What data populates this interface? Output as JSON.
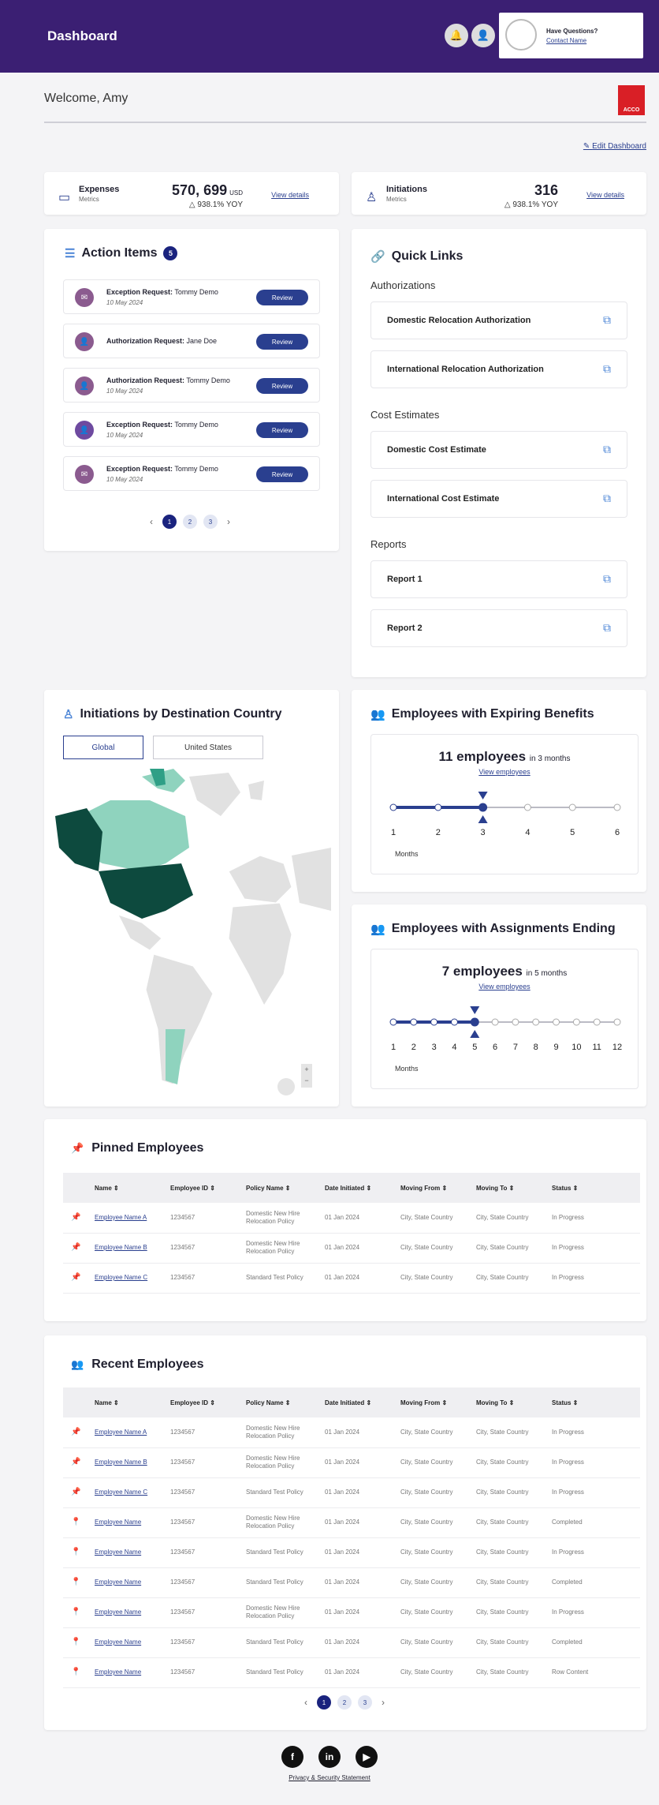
{
  "header": {
    "title": "Dashboard",
    "contact_question": "Have Questions?",
    "contact_link": "Contact Name"
  },
  "welcome": "Welcome, Amy",
  "logo_text": "ACCO",
  "edit_dashboard": "Edit Dashboard",
  "metrics": [
    {
      "label": "Expenses",
      "sub": "Metrics",
      "value": "570, 699",
      "unit": "USD",
      "yoy": "△ 938.1% YOY",
      "link": "View details"
    },
    {
      "label": "Initiations",
      "sub": "Metrics",
      "value": "316",
      "unit": "",
      "yoy": "△ 938.1% YOY",
      "link": "View details"
    }
  ],
  "action_items": {
    "title": "Action Items",
    "count": "5",
    "button": "Review",
    "items": [
      {
        "type": "Exception Request:",
        "who": "Tommy Demo",
        "date": "10 May 2024"
      },
      {
        "type": "Authorization Request:",
        "who": "Jane Doe",
        "date": ""
      },
      {
        "type": "Authorization Request:",
        "who": "Tommy Demo",
        "date": "10 May 2024"
      },
      {
        "type": "Exception Request:",
        "who": "Tommy Demo",
        "date": "10 May 2024"
      },
      {
        "type": "Exception Request:",
        "who": "Tommy Demo",
        "date": "10 May 2024"
      }
    ],
    "pages": [
      "1",
      "2",
      "3"
    ]
  },
  "quick_links": {
    "title": "Quick Links",
    "groups": [
      {
        "heading": "Authorizations",
        "links": [
          "Domestic Relocation Authorization",
          "International Relocation Authorization"
        ]
      },
      {
        "heading": "Cost Estimates",
        "links": [
          "Domestic Cost Estimate",
          "International Cost Estimate"
        ]
      },
      {
        "heading": "Reports",
        "links": [
          "Report 1",
          "Report 2"
        ]
      }
    ]
  },
  "initiations_map": {
    "title": "Initiations by Destination Country",
    "tabs": [
      "Global",
      "United States"
    ],
    "active_tab": "Global",
    "colors": {
      "high": "#0d4a3e",
      "mid": "#2f9f86",
      "low": "#8fd3be",
      "none": "#e1e1e1"
    }
  },
  "expiring": {
    "title": "Employees with Expiring Benefits",
    "count": "11 employees",
    "suffix": "in 3 months",
    "link": "View employees",
    "months": [
      "1",
      "2",
      "3",
      "4",
      "5",
      "6"
    ],
    "current": 3,
    "axis_label": "Months"
  },
  "assignments": {
    "title": "Employees with Assignments Ending",
    "count": "7 employees",
    "suffix": "in 5 months",
    "link": "View employees",
    "months": [
      "1",
      "2",
      "3",
      "4",
      "5",
      "6",
      "7",
      "8",
      "9",
      "10",
      "11",
      "12"
    ],
    "current": 5,
    "axis_label": "Months"
  },
  "table_headers": [
    "Name ⇕",
    "Employee ID ⇕",
    "Policy Name ⇕",
    "Date Initiated ⇕",
    "Moving From ⇕",
    "Moving To ⇕",
    "Status ⇕"
  ],
  "pinned": {
    "title": "Pinned Employees",
    "rows": [
      {
        "name": "Employee Name A",
        "id": "1234567",
        "policy": "Domestic New Hire Relocation Policy",
        "date": "01 Jan 2024",
        "from": "City, State Country",
        "to": "City, State Country",
        "status": "In Progress",
        "pinned": true
      },
      {
        "name": "Employee Name B",
        "id": "1234567",
        "policy": "Domestic New Hire Relocation Policy",
        "date": "01 Jan 2024",
        "from": "City, State Country",
        "to": "City, State Country",
        "status": "In Progress",
        "pinned": true
      },
      {
        "name": "Employee Name C",
        "id": "1234567",
        "policy": "Standard Test Policy",
        "date": "01 Jan 2024",
        "from": "City, State Country",
        "to": "City, State Country",
        "status": "In Progress",
        "pinned": true
      }
    ]
  },
  "recent": {
    "title": "Recent Employees",
    "pages": [
      "1",
      "2",
      "3"
    ],
    "rows": [
      {
        "name": "Employee Name A",
        "id": "1234567",
        "policy": "Domestic New Hire Relocation Policy",
        "date": "01 Jan 2024",
        "from": "City, State Country",
        "to": "City, State Country",
        "status": "In Progress",
        "pinned": true
      },
      {
        "name": "Employee Name B",
        "id": "1234567",
        "policy": "Domestic New Hire Relocation Policy",
        "date": "01 Jan 2024",
        "from": "City, State Country",
        "to": "City, State Country",
        "status": "In Progress",
        "pinned": true
      },
      {
        "name": "Employee Name C",
        "id": "1234567",
        "policy": "Standard Test Policy",
        "date": "01 Jan 2024",
        "from": "City, State Country",
        "to": "City, State Country",
        "status": "In Progress",
        "pinned": true
      },
      {
        "name": "Employee Name",
        "id": "1234567",
        "policy": "Domestic New Hire Relocation Policy",
        "date": "01 Jan 2024",
        "from": "City, State Country",
        "to": "City, State Country",
        "status": "Completed",
        "pinned": false
      },
      {
        "name": "Employee Name",
        "id": "1234567",
        "policy": "Standard Test Policy",
        "date": "01 Jan 2024",
        "from": "City, State Country",
        "to": "City, State Country",
        "status": "In Progress",
        "pinned": false
      },
      {
        "name": "Employee Name",
        "id": "1234567",
        "policy": "Standard Test Policy",
        "date": "01 Jan 2024",
        "from": "City, State Country",
        "to": "City, State Country",
        "status": "Completed",
        "pinned": false
      },
      {
        "name": "Employee Name",
        "id": "1234567",
        "policy": "Domestic New Hire Relocation Policy",
        "date": "01 Jan 2024",
        "from": "City, State Country",
        "to": "City, State Country",
        "status": "In Progress",
        "pinned": false
      },
      {
        "name": "Employee Name",
        "id": "1234567",
        "policy": "Standard Test Policy",
        "date": "01 Jan 2024",
        "from": "City, State Country",
        "to": "City, State Country",
        "status": "Completed",
        "pinned": false
      },
      {
        "name": "Employee Name",
        "id": "1234567",
        "policy": "Standard Test Policy",
        "date": "01 Jan 2024",
        "from": "City, State Country",
        "to": "City, State Country",
        "status": "Row Content",
        "pinned": false
      }
    ]
  },
  "footer": {
    "social": [
      "f",
      "in",
      "▶"
    ],
    "privacy": "Privacy & Security Statement"
  }
}
